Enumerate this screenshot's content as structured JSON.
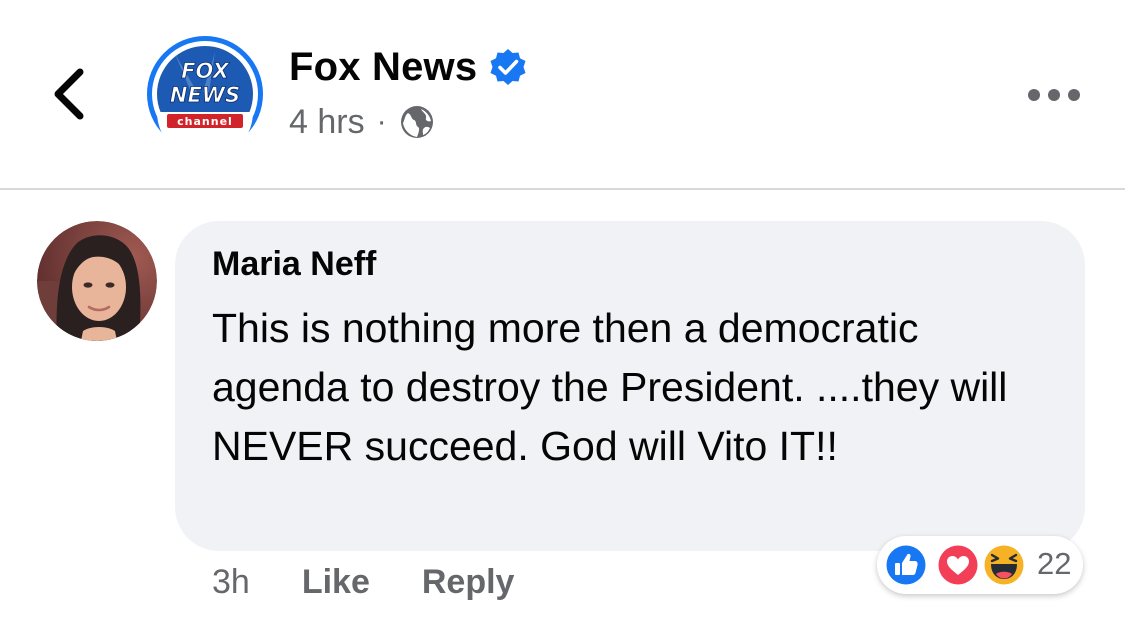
{
  "header": {
    "page_name": "Fox News",
    "time": "4 hrs",
    "separator": "·",
    "logo_text": {
      "line1": "FOX",
      "line2": "NEWS",
      "line3": "channel"
    },
    "icons": {
      "back": "chevron-left-icon",
      "verified": "verified-badge-icon",
      "privacy": "globe-icon",
      "more": "more-horizontal-icon"
    }
  },
  "comment": {
    "author": "Maria Neff",
    "text": "This is nothing more then a democratic agenda to destroy the President. ....they will NEVER succeed. God will Vito IT!!",
    "time": "3h",
    "like_label": "Like",
    "reply_label": "Reply",
    "reactions": {
      "types": [
        "like",
        "love",
        "haha"
      ],
      "count": "22"
    }
  },
  "colors": {
    "brand_blue": "#1877f2",
    "bubble_bg": "#f0f2f5",
    "secondary_text": "#65676b",
    "love_red": "#f33e58",
    "haha_yellow": "#f7b125",
    "fox_blue": "#1c5ab3",
    "fox_red": "#d0232a"
  }
}
